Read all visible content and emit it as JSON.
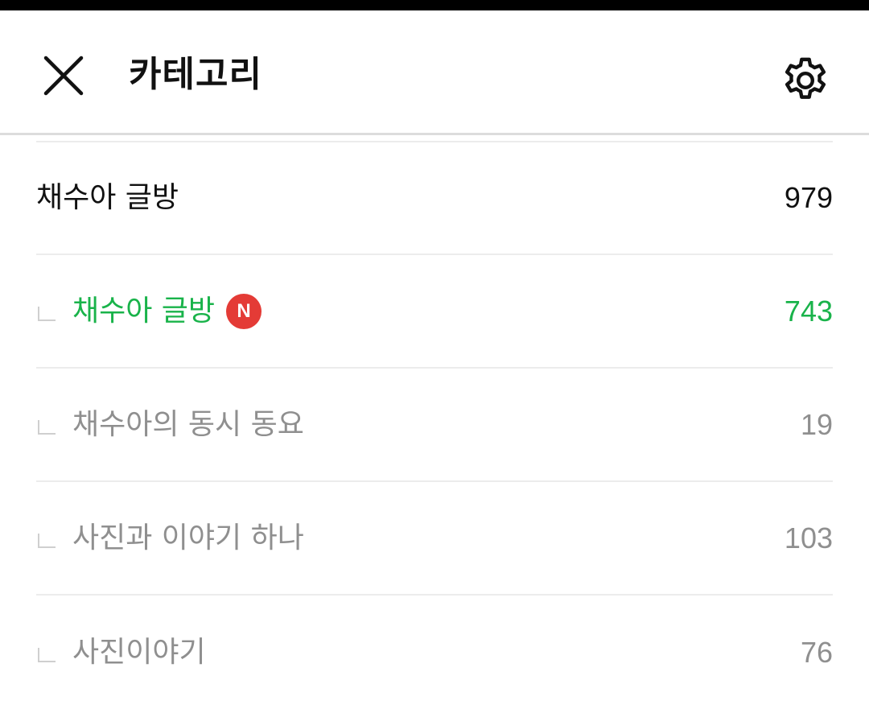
{
  "colors": {
    "accent_green": "#19b34a",
    "badge_red": "#e43b36",
    "muted_text": "#8f8f8f",
    "primary_text": "#111111"
  },
  "header": {
    "title": "카테고리",
    "close_icon": "close-icon",
    "settings_icon": "gear-icon"
  },
  "categories": [
    {
      "label": "채수아 글방",
      "count": "979"
    },
    {
      "label": "채수아 글방",
      "count": "743",
      "badge": "N"
    },
    {
      "label": "채수아의 동시 동요",
      "count": "19"
    },
    {
      "label": "사진과 이야기 하나",
      "count": "103"
    },
    {
      "label": "사진이야기",
      "count": "76"
    }
  ]
}
